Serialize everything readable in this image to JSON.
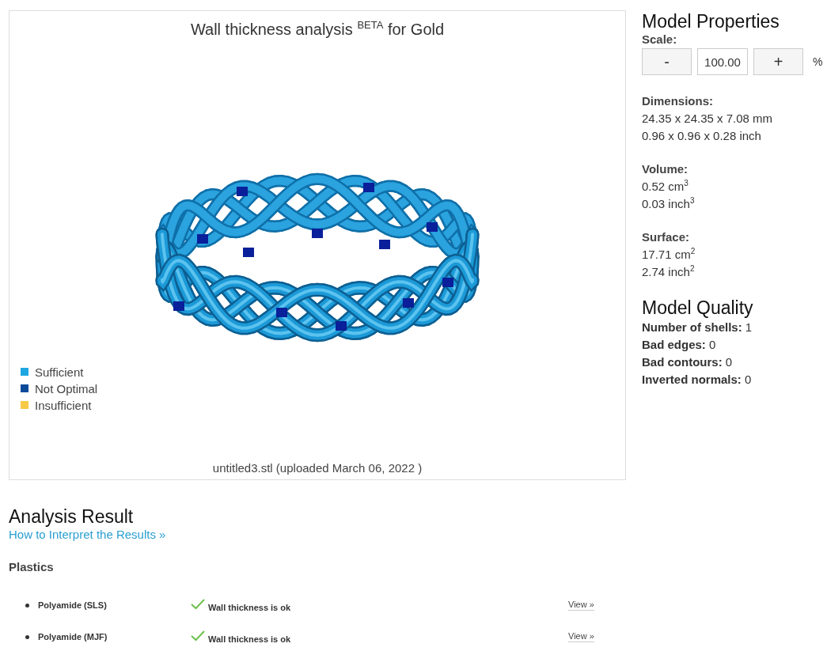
{
  "viewer": {
    "title": "Wall thickness analysis $^{BETA}$ for Gold",
    "legend": [
      {
        "label": "Sufficient",
        "color": "#1ea7e1"
      },
      {
        "label": "Not Optimal",
        "color": "#0d4a9a"
      },
      {
        "label": "Insufficient",
        "color": "#f7c948"
      }
    ],
    "file": "untitled3.stl (uploaded March 06, 2022 )"
  },
  "properties": {
    "title": "Model Properties",
    "scale": {
      "label": "Scale:",
      "minus": "-",
      "value": "100.00",
      "plus": "+",
      "unit": "%"
    },
    "sections": [
      {
        "label": "Dimensions:",
        "lines": [
          "24.35 x 24.35 x 7.08 mm",
          "0.96 x 0.96 x 0.28 inch"
        ]
      },
      {
        "label": "Volume:",
        "lines": [
          "0.52 cm$^{3}$",
          "0.03 inch$^{3}$"
        ]
      },
      {
        "label": "Surface:",
        "lines": [
          "17.71 cm$^{2}$",
          "2.74 inch$^{2}$"
        ]
      }
    ]
  },
  "quality": {
    "title": "Model Quality",
    "items": [
      "**Number of shells:** 1",
      "**Bad edges:** 0",
      "**Bad contours:** 0",
      "**Inverted normals:** 0"
    ]
  },
  "analysis": {
    "title": "Analysis Result",
    "link": "How to Interpret the Results »",
    "groups": [
      {
        "title": "Plastics",
        "rows": [
          {
            "material": "Polyamide (SLS)",
            "ok": true,
            "status": "Wall thickness is ok",
            "action": "View »"
          },
          {
            "material": "Polyamide (MJF)",
            "ok": true,
            "status": "Wall thickness is ok",
            "action": "View »"
          }
        ]
      }
    ]
  }
}
